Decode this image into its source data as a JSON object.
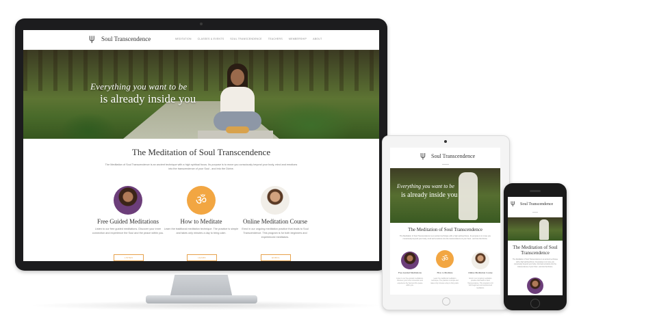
{
  "site": {
    "name": "Soul Transcendence",
    "logo_icon": "tree-logo-icon"
  },
  "nav": {
    "items": [
      "Meditation",
      "Classes & Events",
      "Soul Transcendence",
      "Teachers",
      "Membership",
      "About"
    ]
  },
  "hero": {
    "line1": "Everything you want to be",
    "line2": "is already inside you"
  },
  "content": {
    "title": "The Meditation of Soul Transcendence",
    "intro": "The Meditation of Soul Transcendence is an ancient technique with a high spiritual focus. Its purpose is to move you consciously beyond your body, mind and emotions into the transcendence of your Soul - and into the Divine."
  },
  "cards": [
    {
      "title": "Free Guided Meditations",
      "text": "Listen to our free guided meditations. Discover your inner connection and experience the Soul and the peace within you.",
      "button": "LISTEN",
      "icon": "meditator-portrait"
    },
    {
      "title": "How to Meditate",
      "text": "Learn the traditional meditation technique. The practice is simple and takes only minutes a day to bring calm.",
      "button": "LEARN",
      "icon": "om-symbol-icon"
    },
    {
      "title": "Online Meditation Course",
      "text": "Enrol in our ongoing meditation practice that leads to Soul Transcendence. This program is for both beginners and experienced meditators.",
      "button": "ENROL",
      "icon": "teacher-portrait"
    }
  ],
  "colors": {
    "accent": "#f2a642",
    "device_dark": "#1c1c1e"
  }
}
